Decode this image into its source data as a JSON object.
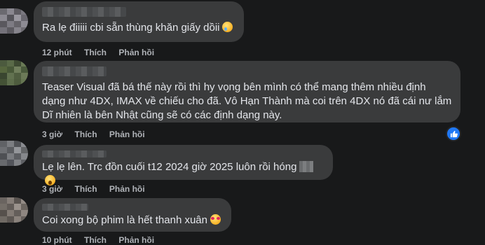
{
  "comments": [
    {
      "text": "Ra lẹ điiiii cbi sẵn thùng khăn giấy dồii",
      "emoji": "tearful-face-emoji",
      "time": "12 phút",
      "like": "Thích",
      "reply": "Phản hồi"
    },
    {
      "text": "Teaser Visual đã bá thế này rồi thì hy vọng bên mình có thể mang thêm nhiều định\ndạng như 4DX, IMAX về chiếu cho đã. Vô Hạn Thành mà coi trên 4DX nó đã cái nư lắm\nDĩ nhiên là bên Nhật cũng sẽ có các định dạng này.",
      "time": "3 giờ",
      "like": "Thích",
      "reply": "Phản hồi",
      "reaction": "like-reaction-icon"
    },
    {
      "text": "Lẹ lẹ lên. Trc đồn cuối t12 2024 giờ 2025 luôn rồi hóng",
      "emoji": "astonished-face-emoji",
      "time": "3 giờ",
      "like": "Thích",
      "reply": "Phản hồi"
    },
    {
      "text": "Coi xong bộ phim là hết thanh xuân",
      "emoji": "heart-eyes-face-emoji",
      "time": "10 phút",
      "like": "Thích",
      "reply": "Phản hồi"
    }
  ],
  "colors": {
    "background": "#18191a",
    "bubble": "#3a3b3c",
    "meta": "#b0b3b8",
    "like_badge": "#2078f4"
  }
}
